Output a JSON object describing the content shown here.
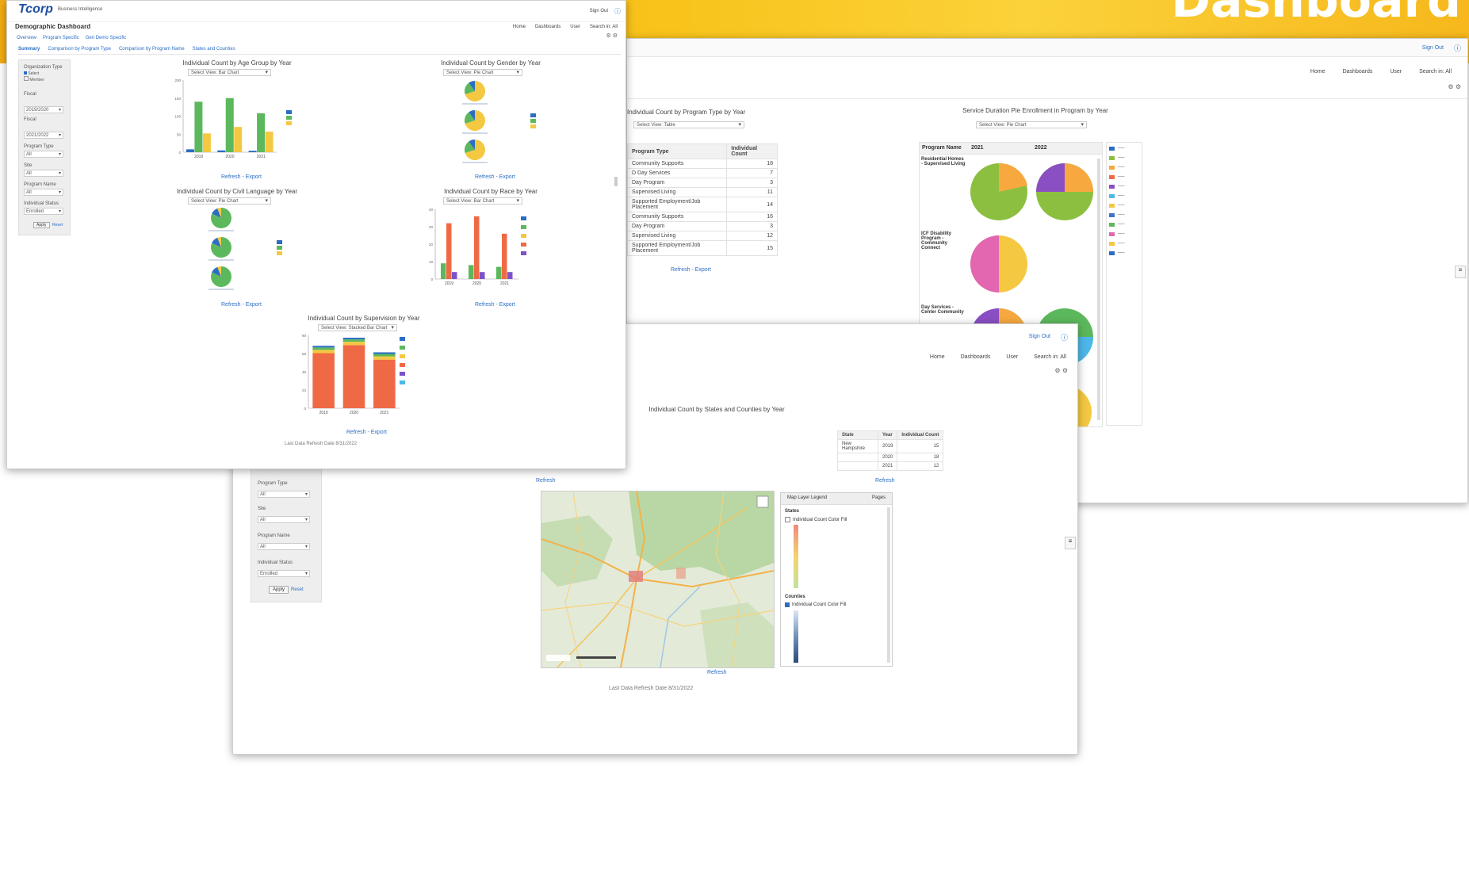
{
  "banner": {
    "title": "Dashboard",
    "colors": {
      "left": "#f3ac12",
      "right": "#f6b81c"
    }
  },
  "colors": {
    "blue": "#2a6dc4",
    "green": "#5cb85c",
    "yellow": "#f5c842",
    "orange": "#ef6a44",
    "purple": "#7b52c9",
    "pink": "#e266b0",
    "lime": "#8cbf3f",
    "amber": "#f7a940"
  },
  "main_window": {
    "logo": "Tcorp",
    "app_name": "Business Intelligence",
    "signout": "Sign Out",
    "dashboard_title": "Demographic Dashboard",
    "nav_tabs": [
      "Overview",
      "Program Specific",
      "Gen Demo Specific"
    ],
    "header_menu": [
      "Home",
      "Dashboards",
      "User",
      "Search in: All"
    ],
    "subtabs": [
      "Summary",
      "Comparison by Program Type",
      "Comparison by Program Name",
      "States and Counties"
    ],
    "filters": {
      "title": "Organization Type",
      "options": [
        "Select",
        "Member"
      ],
      "fields": [
        {
          "label": "Fiscal",
          "value": "2019/2020"
        },
        {
          "label": "Fiscal",
          "value": "2021/2022"
        },
        {
          "label": "Program Type",
          "value": "All"
        },
        {
          "label": "Site",
          "value": "All"
        },
        {
          "label": "Program Name",
          "value": "All"
        },
        {
          "label": "Individual Status",
          "value": "Enrolled"
        }
      ],
      "apply": "Apply",
      "reset": "Reset"
    },
    "footer": "Last Data Refresh Date 8/31/2022"
  },
  "panels": {
    "age": {
      "title": "Individual Count by Age Group by Year",
      "dropdown": "Select View: Bar Chart",
      "links": "Refresh - Export"
    },
    "gender": {
      "title": "Individual Count by Gender by Year",
      "dropdown": "Select View: Pie Chart",
      "links": "Refresh - Export"
    },
    "language": {
      "title": "Individual Count by Civil Language by Year",
      "dropdown": "Select View: Pie Chart",
      "links": "Refresh - Export"
    },
    "race": {
      "title": "Individual Count by Race by Year",
      "dropdown": "Select View: Bar Chart",
      "links": "Refresh - Export"
    },
    "supervision": {
      "title": "Individual Count by Supervision by Year",
      "dropdown": "Select View: Stacked Bar Chart",
      "links": "Refresh - Export"
    }
  },
  "chart_data": [
    {
      "type": "bar",
      "title": "Individual Count by Age Group by Year",
      "categories": [
        "2019",
        "2020",
        "2021"
      ],
      "ylim": [
        0,
        200
      ],
      "series": [
        {
          "values": [
            8,
            5,
            4
          ]
        },
        {
          "values": [
            140,
            150,
            108
          ]
        },
        {
          "values": [
            52,
            70,
            57
          ]
        }
      ]
    },
    {
      "type": "bar",
      "title": "Individual Count by Race by Year",
      "categories": [
        "2019",
        "2020",
        "2021"
      ],
      "ylim": [
        0,
        40
      ],
      "series": [
        {
          "values": [
            9,
            8,
            7
          ]
        },
        {
          "values": [
            32,
            36,
            26
          ]
        },
        {
          "values": [
            4,
            4,
            4
          ]
        }
      ]
    },
    {
      "type": "bar",
      "title": "Individual Count by Supervision by Year",
      "categories": [
        "2019",
        "2020",
        "2021"
      ],
      "ylim": [
        0,
        90
      ],
      "series": [
        {
          "values": [
            68,
            78,
            60
          ]
        },
        {
          "values": [
            4,
            4,
            4
          ]
        },
        {
          "values": [
            3,
            3,
            3
          ]
        },
        {
          "values": [
            2,
            2,
            2
          ]
        }
      ]
    },
    {
      "type": "pie",
      "title": "Individual Count by Gender by Year",
      "values": [
        0.7,
        0.2,
        0.1
      ]
    },
    {
      "type": "pie",
      "title": "Individual Count by Civil Language by Year",
      "values": [
        0.82,
        0.12,
        0.06
      ]
    }
  ],
  "right_window": {
    "signout": "Sign Out",
    "header_menu": [
      "Home",
      "Dashboards",
      "User",
      "Search in: All"
    ],
    "table_title": "Individual Count by Program Type by Year",
    "table_dropdown": "Select View: Table",
    "table_headers": [
      "Program Type",
      "Individual Count"
    ],
    "table_rows": [
      [
        "Community Supports",
        "18"
      ],
      [
        "D Day Services",
        "7"
      ],
      [
        "Day Program",
        "3"
      ],
      [
        "Supervised Living",
        "11"
      ],
      [
        "Supported Employment/Job Placement",
        "14"
      ],
      [
        "Community Supports",
        "16"
      ],
      [
        "Day Program",
        "3"
      ],
      [
        "Supervised Living",
        "12"
      ],
      [
        "Supported Employment/Job Placement",
        "15"
      ]
    ],
    "table_links": "Refresh - Export",
    "pie_title": "Service Duration Pie Enrollment in Program by Year",
    "pie_dropdown": "Select View: Pie Chart",
    "pie_headers": [
      "Program Name",
      "2021",
      "2022"
    ],
    "pie_rows": [
      "Residential Homes - Supervised Living",
      "ICF Disability Program - Community Connect",
      "Day Services - Center Community"
    ]
  },
  "map_window": {
    "signout": "Sign Out",
    "header_menu": [
      "Home",
      "Dashboards",
      "User",
      "Search in: All"
    ],
    "title": "Individual Count by States and Counties by Year",
    "table_headers": [
      "State",
      "Year",
      "Individual Count"
    ],
    "table_rows": [
      [
        "New Hampshire",
        "2019",
        "15"
      ],
      [
        "",
        "2020",
        "18"
      ],
      [
        "",
        "2021",
        "12"
      ]
    ],
    "map_legend_title": "Map Layer Legend",
    "map_legend_button": "Pages",
    "legend_states": "States",
    "legend_states_item": "Individual Count Color Fill",
    "legend_counties": "Counties",
    "legend_counties_item": "Individual Count Color Fill",
    "filters": [
      {
        "label": "Program Type",
        "value": "All"
      },
      {
        "label": "Site",
        "value": "All"
      },
      {
        "label": "Program Name",
        "value": "All"
      },
      {
        "label": "Individual Status",
        "value": "Enrolled"
      }
    ],
    "apply": "Apply",
    "reset": "Reset",
    "refresh": "Refresh",
    "footer": "Last Data Refresh Date 8/31/2022"
  }
}
